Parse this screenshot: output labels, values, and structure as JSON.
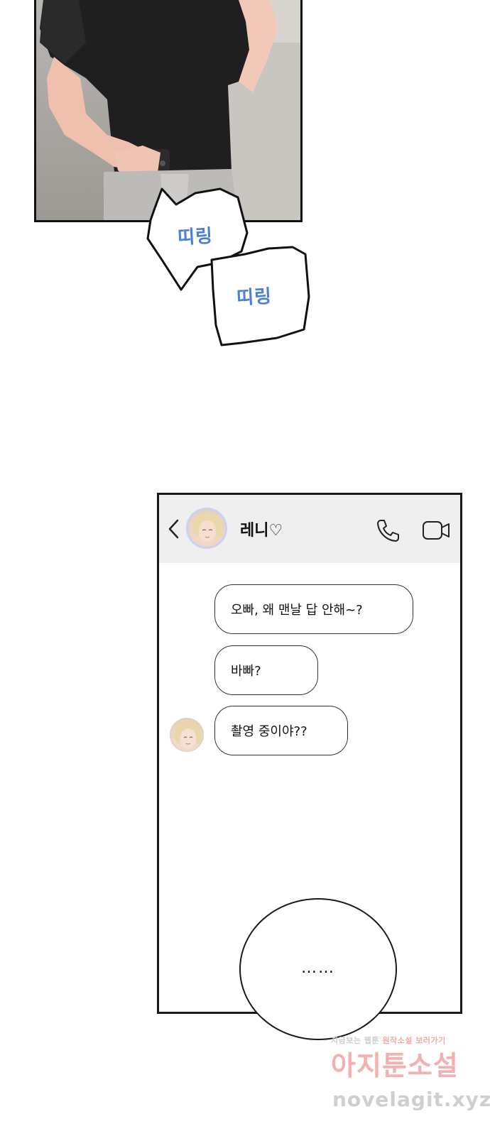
{
  "sfx": [
    "띠링",
    "띠링"
  ],
  "chat": {
    "contact_name": "레니♡",
    "messages": [
      "오빠, 왜 맨날 답 안해~?",
      "바빠?",
      "촬영 중이야??"
    ]
  },
  "thought_text": "……",
  "watermark": {
    "line1_prefix": "지금보는 웹툰",
    "line1_highlight": "원작소설 보러가기",
    "brand": "아지툰소설",
    "url": "novelagit.xyz"
  },
  "icons": [
    "back-chevron-icon",
    "phone-icon",
    "video-call-icon"
  ],
  "colors": {
    "sfx": "#4d7fd2",
    "header_bg": "#efefef",
    "avatar_ring": "#c8d2f5",
    "watermark_pink": "#f2b0b0"
  }
}
